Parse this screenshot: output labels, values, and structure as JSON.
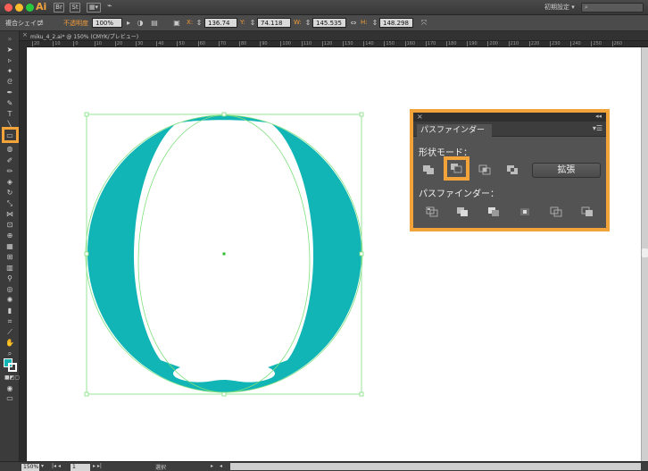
{
  "titlebar": {
    "app_logo": "Ai",
    "workspace": "初期設定",
    "search_placeholder": "",
    "icons": [
      "bridge-icon",
      "stock-icon",
      "arrange-documents-icon",
      "gpu-icon"
    ]
  },
  "controlbar": {
    "object_type": "複合シェイプ",
    "opacity_label": "不透明度",
    "opacity_value": "100%",
    "x_label": "X:",
    "x_value": "136.74 mm",
    "y_label": "Y:",
    "y_value": "74.118 mm",
    "w_label": "W:",
    "w_value": "145.535 mm",
    "h_label": "H:",
    "h_value": "148.298 mm"
  },
  "document": {
    "tab_title": "miku_4_2.ai* @ 150% (CMYK/プレビュー)",
    "ruler_ticks": [
      "20",
      "10",
      "0",
      "10",
      "20",
      "30",
      "40",
      "50",
      "60",
      "70",
      "80",
      "90",
      "100",
      "110",
      "120",
      "130",
      "140",
      "150",
      "160",
      "170",
      "180",
      "190",
      "200",
      "210",
      "220",
      "230",
      "240",
      "250",
      "260"
    ]
  },
  "statusbar": {
    "zoom": "150%",
    "page": "1",
    "tool_status": "選択"
  },
  "pathfinder": {
    "tab_label": "パスファインダー",
    "shape_modes_label": "形状モード：",
    "expand_label": "拡張",
    "pathfinders_label": "パスファインダー：",
    "shape_mode_buttons": [
      "unite-icon",
      "minus-front-icon",
      "intersect-icon",
      "exclude-icon"
    ],
    "pathfinder_buttons": [
      "divide-icon",
      "trim-icon",
      "merge-icon",
      "crop-icon",
      "outline-icon",
      "minus-back-icon"
    ],
    "highlighted_button": "minus-front-icon"
  },
  "artwork": {
    "fill_color": "#12b5b5",
    "selection_color": "#7fe07f",
    "highlight_color": "#f2a33a"
  }
}
